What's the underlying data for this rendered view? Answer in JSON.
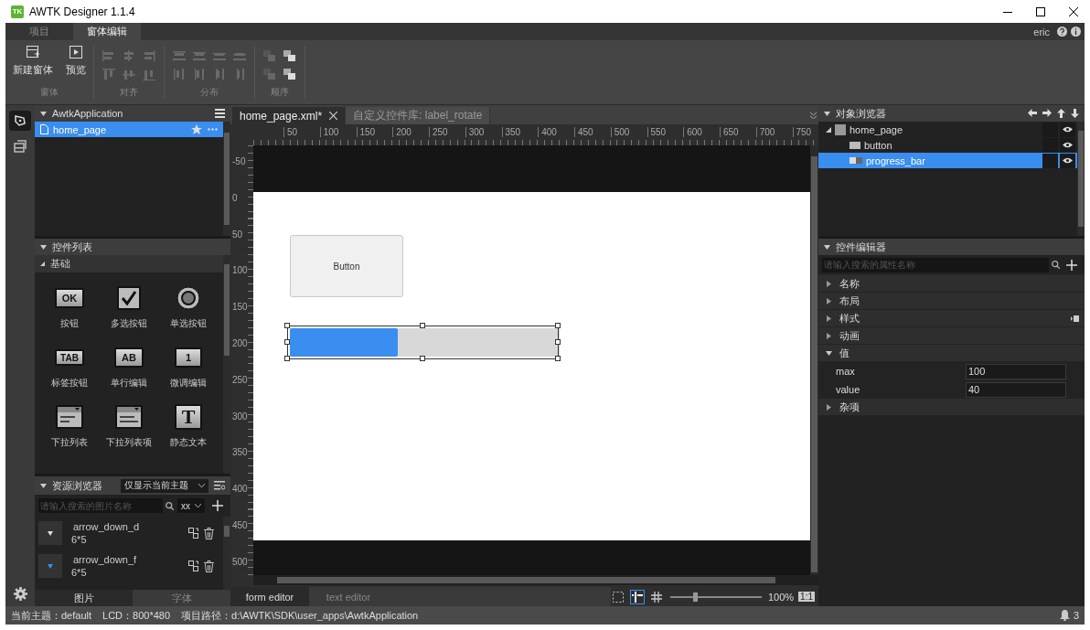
{
  "window": {
    "logo": "TK",
    "title": "AWTK Designer  1.1.4"
  },
  "ribbon_tabs": [
    {
      "label": "项目",
      "selected": false
    },
    {
      "label": "窗体编辑",
      "selected": true
    }
  ],
  "user": "eric",
  "ribbon_groups": [
    {
      "label": "窗体",
      "kind": "form",
      "buttons": [
        "新建窗体",
        "预览"
      ]
    },
    {
      "label": "对齐",
      "kind": "align"
    },
    {
      "label": "分布",
      "kind": "distribute"
    },
    {
      "label": "顺序",
      "kind": "order"
    }
  ],
  "project": {
    "title": "AwtkApplication",
    "files": [
      {
        "name": "home_page",
        "selected": true
      }
    ]
  },
  "widget_list": {
    "title": "控件列表",
    "category": "基础",
    "items": [
      {
        "label": "按钮",
        "kind": "button",
        "glyph": "OK"
      },
      {
        "label": "多选按钮",
        "kind": "check"
      },
      {
        "label": "单选按钮",
        "kind": "radio"
      },
      {
        "label": "标签按钮",
        "kind": "tab",
        "glyph": "TAB"
      },
      {
        "label": "单行编辑",
        "kind": "edit",
        "glyph": "AB"
      },
      {
        "label": "微调编辑",
        "kind": "spin",
        "glyph": "1"
      },
      {
        "label": "下拉列表",
        "kind": "combo"
      },
      {
        "label": "下拉列表项",
        "kind": "combo_item"
      },
      {
        "label": "静态文本",
        "kind": "label",
        "glyph": "T"
      }
    ]
  },
  "resources": {
    "title": "资源浏览器",
    "filter": "仅显示当前主题",
    "search_placeholder": "请输入搜索的图片名称",
    "size": "xx",
    "items": [
      {
        "name": "arrow_down_d",
        "size": "6*5",
        "color": "#e0e0e0"
      },
      {
        "name": "arrow_down_f",
        "size": "6*5",
        "color": "#3a8ef0"
      }
    ],
    "tabs": [
      {
        "label": "图片",
        "selected": true
      },
      {
        "label": "字体",
        "selected": false
      }
    ]
  },
  "editor_tabs": [
    {
      "label": "home_page.xml*",
      "selected": true
    },
    {
      "label": "自定义控件库: label_rotate",
      "selected": false
    }
  ],
  "ruler": {
    "x_labels": [
      "50",
      "100",
      "150",
      "200",
      "250",
      "300",
      "350",
      "400",
      "450",
      "500",
      "550",
      "600",
      "650",
      "700",
      "750"
    ],
    "y_labels": [
      "-50",
      "0",
      "50",
      "100",
      "150",
      "200",
      "250",
      "300",
      "350",
      "400",
      "450",
      "500"
    ]
  },
  "design": {
    "button": {
      "text": "Button"
    },
    "progress": {
      "level": 0.4
    }
  },
  "bottom_tabs": [
    {
      "label": "form editor",
      "selected": true
    },
    {
      "label": "text editor",
      "selected": false
    }
  ],
  "zoom": {
    "level": 0.27,
    "reading": "100%",
    "ratio": "1:1"
  },
  "objects": {
    "title": "对象浏览器",
    "tree": [
      {
        "name": "home_page",
        "selected": false,
        "children": [
          {
            "name": "button",
            "kind": "button",
            "selected": false
          },
          {
            "name": "progress_bar",
            "kind": "progress",
            "selected": true
          }
        ]
      }
    ]
  },
  "props": {
    "title": "控件编辑器",
    "search_placeholder": "请输入搜索的属性名称",
    "groups": [
      {
        "label": "名称",
        "expanded": false
      },
      {
        "label": "布局",
        "expanded": false
      },
      {
        "label": "样式",
        "expanded": false
      },
      {
        "label": "动画",
        "expanded": false
      },
      {
        "label": "值",
        "expanded": true,
        "fields": [
          {
            "label": "max",
            "value": "100"
          },
          {
            "label": "value",
            "value": "40"
          }
        ]
      },
      {
        "label": "杂项",
        "expanded": false
      }
    ]
  },
  "status": {
    "theme": "当前主题：default",
    "lcd": "LCD：800*480",
    "path": "项目路径：d:\\AWTK\\SDK\\user_apps\\AwtkApplication",
    "notifications": "3"
  }
}
